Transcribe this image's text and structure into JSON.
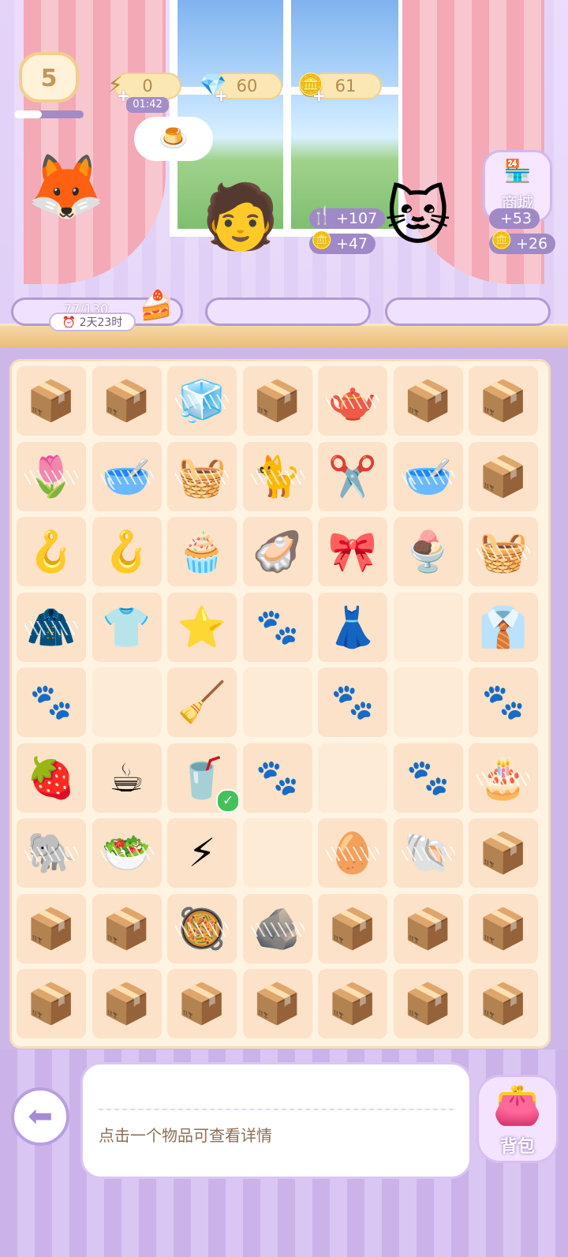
{
  "hud": {
    "level": "5",
    "level_progress": 0.4,
    "energy": "0",
    "energy_timer": "01:42",
    "gems": "60",
    "coins": "61"
  },
  "order_bubble_item": "🍮",
  "orders": [
    {
      "progress_text": "77/130",
      "deadline": "2天23时",
      "cake": "🍰"
    },
    {
      "exp_reward": "+107",
      "coin_reward": "+47"
    },
    {
      "exp_reward": "+53",
      "coin_reward": "+26"
    }
  ],
  "shop": {
    "label": "商城",
    "badge": "SHOP"
  },
  "board": {
    "rows": [
      [
        "📦",
        "📦",
        "🧊",
        "📦",
        "🫖",
        "📦",
        "📦"
      ],
      [
        "🌷",
        "🥣",
        "🧺",
        "🐈",
        "✂️",
        "🥣",
        "📦"
      ],
      [
        "🪝",
        "🪝",
        "🧁",
        "🦪",
        "🎀",
        "🍨",
        "🧺"
      ],
      [
        "🧥",
        "👕",
        "⭐",
        "🐾",
        "👗",
        "",
        "👔"
      ],
      [
        "🐾",
        "",
        "🧹",
        "",
        "🐾",
        "",
        "🐾"
      ],
      [
        "🍓",
        "☕",
        "🥤",
        "🐾",
        "",
        "🐾",
        "🎂"
      ],
      [
        "🐘",
        "🥗",
        "⚡",
        "",
        "🥚",
        "🐚",
        "📦"
      ],
      [
        "📦",
        "📦",
        "🥘",
        "🪨",
        "📦",
        "📦",
        "📦"
      ],
      [
        "📦",
        "📦",
        "📦",
        "📦",
        "📦",
        "📦",
        "📦"
      ]
    ],
    "webbed": [
      [
        0,
        2
      ],
      [
        0,
        4
      ],
      [
        1,
        0
      ],
      [
        1,
        1
      ],
      [
        1,
        2
      ],
      [
        1,
        3
      ],
      [
        1,
        5
      ],
      [
        2,
        6
      ],
      [
        3,
        0
      ],
      [
        5,
        6
      ],
      [
        6,
        0
      ],
      [
        6,
        1
      ],
      [
        6,
        4
      ],
      [
        6,
        5
      ],
      [
        7,
        2
      ],
      [
        7,
        3
      ]
    ],
    "completed": [
      [
        5,
        2
      ]
    ]
  },
  "info_panel": {
    "text": "点击一个物品可查看详情"
  },
  "bag": {
    "label": "背包"
  },
  "icons": {
    "energy": "⚡",
    "gem": "💎",
    "coin": "🪙",
    "exp": "🍴",
    "clock": "⏰",
    "back": "⬅"
  }
}
